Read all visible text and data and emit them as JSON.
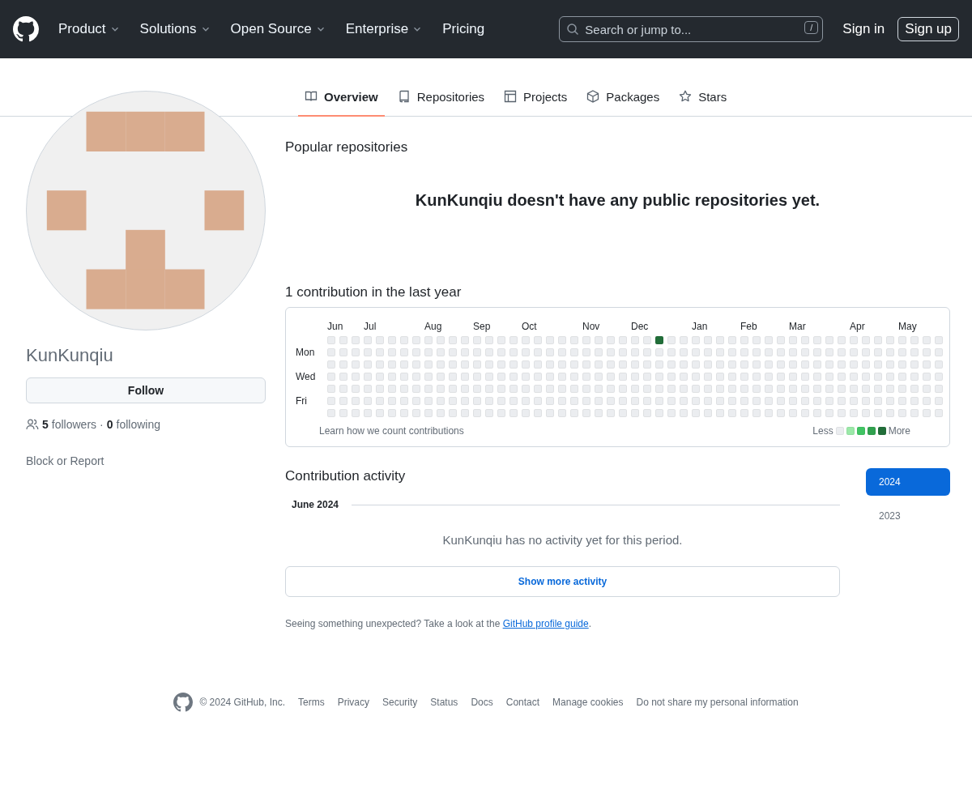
{
  "header": {
    "nav": [
      {
        "label": "Product",
        "dropdown": true
      },
      {
        "label": "Solutions",
        "dropdown": true
      },
      {
        "label": "Open Source",
        "dropdown": true
      },
      {
        "label": "Enterprise",
        "dropdown": true
      },
      {
        "label": "Pricing",
        "dropdown": false
      }
    ],
    "search": {
      "placeholder": "Search or jump to...",
      "shortcut": "/"
    },
    "sign_in": "Sign in",
    "sign_up": "Sign up"
  },
  "tabs": [
    {
      "label": "Overview",
      "selected": true
    },
    {
      "label": "Repositories",
      "selected": false
    },
    {
      "label": "Projects",
      "selected": false
    },
    {
      "label": "Packages",
      "selected": false
    },
    {
      "label": "Stars",
      "selected": false
    }
  ],
  "profile": {
    "username": "KunKunqiu",
    "follow_button": "Follow",
    "followers_count": "5",
    "followers_label": "followers",
    "separator": "·",
    "following_count": "0",
    "following_label": "following",
    "block_link": "Block or Report"
  },
  "popular": {
    "title": "Popular repositories",
    "empty_message": "KunKunqiu doesn't have any public repositories yet."
  },
  "contributions": {
    "title": "1 contribution in the last year",
    "months": [
      "Jun",
      "Jul",
      "Aug",
      "Sep",
      "Oct",
      "Nov",
      "Dec",
      "Jan",
      "Feb",
      "Mar",
      "Apr",
      "May"
    ],
    "weekday_labels": [
      "Mon",
      "Wed",
      "Fri"
    ],
    "learn_link": "Learn how we count contributions",
    "legend_less": "Less",
    "legend_more": "More"
  },
  "activity": {
    "title": "Contribution activity",
    "period": "June 2024",
    "empty_message": "KunKunqiu has no activity yet for this period.",
    "show_more": "Show more activity",
    "years": [
      {
        "label": "2024",
        "selected": true
      },
      {
        "label": "2023",
        "selected": false
      }
    ]
  },
  "guide_note": {
    "text": "Seeing something unexpected? Take a look at the",
    "link": "GitHub profile guide",
    "end": "."
  },
  "footer": {
    "copyright": "© 2024 GitHub, Inc.",
    "links": [
      "Terms",
      "Privacy",
      "Security",
      "Status",
      "Docs",
      "Contact",
      "Manage cookies",
      "Do not share my personal information"
    ]
  }
}
